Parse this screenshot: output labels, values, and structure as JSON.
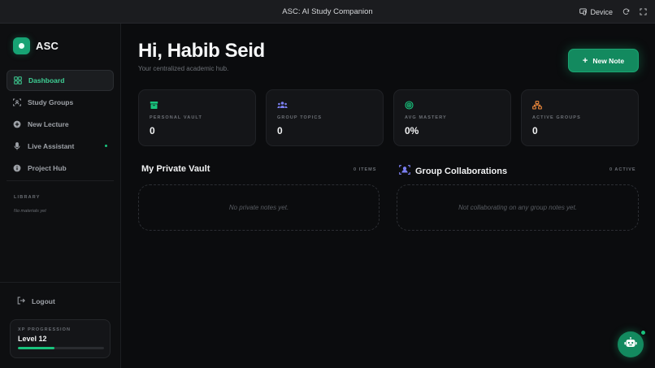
{
  "window": {
    "title": "ASC: AI Study Companion",
    "device_label": "Device"
  },
  "sidebar": {
    "brand": "ASC",
    "items": [
      {
        "label": "Dashboard",
        "icon": "grid-icon",
        "active": true
      },
      {
        "label": "Study Groups",
        "icon": "group-scan-icon",
        "active": false
      },
      {
        "label": "New Lecture",
        "icon": "plus-circle-icon",
        "active": false
      },
      {
        "label": "Live Assistant",
        "icon": "microphone-icon",
        "active": false,
        "live": true
      },
      {
        "label": "Project Hub",
        "icon": "info-circle-icon",
        "active": false
      }
    ],
    "library_title": "LIBRARY",
    "library_empty": "No materials yet",
    "logout_label": "Logout",
    "xp": {
      "label": "XP PROGRESSION",
      "level": "Level 12",
      "progress": 0.42
    }
  },
  "main": {
    "greeting": "Hi, Habib Seid",
    "subtitle": "Your centralized academic hub.",
    "new_note_label": "New Note",
    "stats": [
      {
        "label": "PERSONAL VAULT",
        "value": "0",
        "icon": "archive-icon",
        "color": "#19c37d"
      },
      {
        "label": "GROUP TOPICS",
        "value": "0",
        "icon": "users-icon",
        "color": "#7b7ff0"
      },
      {
        "label": "AVG MASTERY",
        "value": "0%",
        "icon": "target-icon",
        "color": "#19c37d"
      },
      {
        "label": "ACTIVE GROUPS",
        "value": "0",
        "icon": "network-icon",
        "color": "#f08a3c"
      }
    ],
    "vault": {
      "title": "My Private Vault",
      "count": "0 ITEMS",
      "empty": "No private notes yet."
    },
    "collab": {
      "title": "Group Collaborations",
      "count": "0 ACTIVE",
      "empty": "Not collaborating on any group notes yet."
    }
  },
  "colors": {
    "accent": "#19c37d",
    "background": "#0b0c0e"
  }
}
